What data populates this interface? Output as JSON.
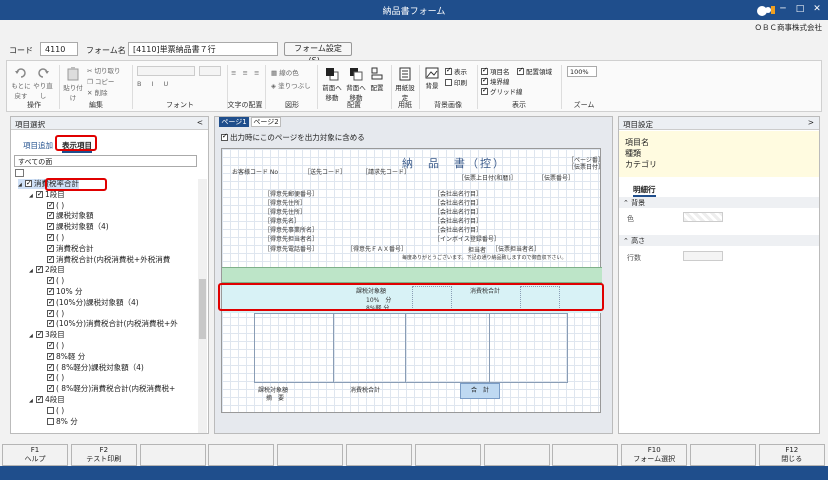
{
  "window": {
    "title": "納品書フォーム",
    "company": "ＯＢＣ商事株式会社"
  },
  "header": {
    "code_label": "コード",
    "code_value": "4110",
    "form_name_label": "フォーム名",
    "form_name_value": "[4110]単票納品書７行",
    "form_settings_button": "フォーム設定(S)..."
  },
  "ribbon": {
    "op_group": "操作",
    "undo": "もとに戻す",
    "redo": "やり直し",
    "edit_group": "編集",
    "paste": "貼り付け",
    "cut": "切り取り",
    "copy": "コピー",
    "delete": "削除",
    "font_group": "フォント",
    "align_group": "文字の配置",
    "shape_group": "図形",
    "line_color": "線の色",
    "fill": "塗りつぶし",
    "arrange_group": "配置",
    "bring_front": "前面へ移動",
    "send_back": "背面へ移動",
    "arrange": "配置",
    "paper_group": "用紙",
    "paper_settings": "用紙設定",
    "bg_group": "背景画像",
    "bg": "背景",
    "show": "表示",
    "print": "印刷",
    "display_group": "表示",
    "item_name": "項目名",
    "border": "境界線",
    "grid": "グリッド線",
    "layout_area": "配置領域",
    "zoom_group": "ズーム",
    "zoom_value": "100%"
  },
  "left_panel": {
    "title": "項目選択",
    "collapse": "<",
    "tab_add": "項目追加",
    "tab_show": "表示項目",
    "filter_value": "すべての面",
    "tree": [
      {
        "label": "消費税率合計",
        "level": 0,
        "checked": true,
        "arrow": true,
        "selected": true
      },
      {
        "label": "1段目",
        "level": 1,
        "checked": true,
        "arrow": true
      },
      {
        "label": "(                    )",
        "level": 2,
        "checked": true
      },
      {
        "label": "課税対象額",
        "level": 2,
        "checked": true
      },
      {
        "label": "課税対象額（4)",
        "level": 2,
        "checked": true
      },
      {
        "label": "(                    )",
        "level": 2,
        "checked": true
      },
      {
        "label": "消費税合計",
        "level": 2,
        "checked": true
      },
      {
        "label": "消費税合計(内税消費税+外税消費",
        "level": 2,
        "checked": true
      },
      {
        "label": "2段目",
        "level": 1,
        "checked": true,
        "arrow": true
      },
      {
        "label": "(                    )",
        "level": 2,
        "checked": true
      },
      {
        "label": "10%     分",
        "level": 2,
        "checked": true
      },
      {
        "label": "(10%分)課税対象額（4)",
        "level": 2,
        "checked": true
      },
      {
        "label": "(                    )",
        "level": 2,
        "checked": true
      },
      {
        "label": "(10%分)消費税合計(内税消費税+外",
        "level": 2,
        "checked": true
      },
      {
        "label": "3段目",
        "level": 1,
        "checked": true,
        "arrow": true
      },
      {
        "label": "(                    )",
        "level": 2,
        "checked": true
      },
      {
        "label": "8%軽 分",
        "level": 2,
        "checked": true
      },
      {
        "label": "( 8%軽分)課税対象額（4)",
        "level": 2,
        "checked": true
      },
      {
        "label": "(                    )",
        "level": 2,
        "checked": true
      },
      {
        "label": "( 8%軽分)消費税合計(内税消費税+",
        "level": 2,
        "checked": true
      },
      {
        "label": "4段目",
        "level": 1,
        "checked": true,
        "arrow": true
      },
      {
        "label": "(                    )",
        "level": 2,
        "checked": false
      },
      {
        "label": "8%     分",
        "level": 2,
        "checked": false
      }
    ]
  },
  "center": {
    "tab1": "ページ1",
    "tab2": "ページ2",
    "output_check": "出力時にこのページを出力対象に含める",
    "form": {
      "title": "納　品　書（控）",
      "customer_code_label": "お客様コード No",
      "customer_code": "［送先コード］",
      "request_code": "［請求先コード］",
      "page": "［ページ番］",
      "date": "［伝票日付］",
      "slip_no": "［伝票番号］",
      "note_no": "［伝票上日付(和暦)］",
      "zip": "［得意先郵便番号］",
      "addr1": "［得意先住所］",
      "addr2": "［得意先住所］",
      "name": "［得意先名］",
      "dept": "［得意先事業所名］",
      "person": "［得意先担当者名］",
      "tel": "［得意先電話番号］",
      "fax": "［得意先ＦＡＸ番号］",
      "company_lines": [
        "［会社出名行目］",
        "［会社出名行目］",
        "［会社出名行目］",
        "［会社出名行目］",
        "［会社出名行目］"
      ],
      "invoice_no": "［インボイス登録番号］",
      "staff_label": "担当者",
      "staff": "［伝票担当者名］",
      "thanks": "毎度ありがとうございます。下記の通り納品致しますので御査収下さい。",
      "tax_target": "課税対象額",
      "tax_sum": "消費税合計",
      "r10": "10%　分",
      "r8": "8%軽 分",
      "total": "合　計",
      "remarks": "摘　要"
    }
  },
  "right_panel": {
    "title": "項目設定",
    "collapse": ">",
    "info": [
      "項目名",
      "種類",
      "カテゴリ"
    ],
    "tab": "明細行",
    "section_bg": "背景",
    "color_label": "色",
    "section_height": "高さ",
    "rows_label": "行数"
  },
  "fkeys": [
    {
      "key": "F1",
      "label": "ヘルプ"
    },
    {
      "key": "F2",
      "label": "テスト印刷"
    },
    {
      "key": "",
      "label": ""
    },
    {
      "key": "",
      "label": ""
    },
    {
      "key": "",
      "label": ""
    },
    {
      "key": "",
      "label": ""
    },
    {
      "key": "",
      "label": ""
    },
    {
      "key": "",
      "label": ""
    },
    {
      "key": "",
      "label": ""
    },
    {
      "key": "F10",
      "label": "フォーム選択"
    },
    {
      "key": "",
      "label": ""
    },
    {
      "key": "F12",
      "label": "閉じる"
    }
  ]
}
